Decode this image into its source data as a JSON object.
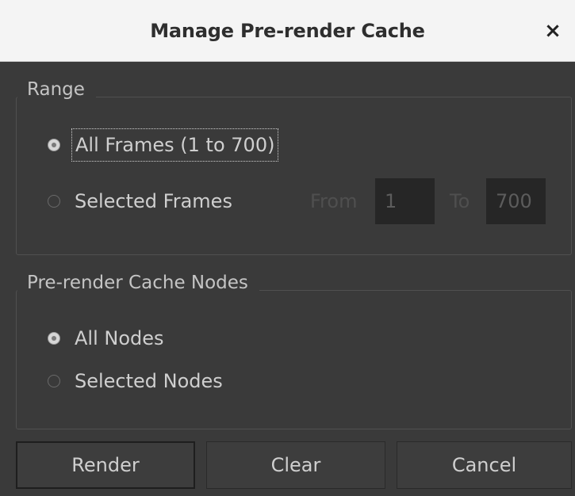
{
  "dialog": {
    "title": "Manage Pre-render Cache",
    "close_glyph": "×"
  },
  "range": {
    "title": "Range",
    "all_frames_label": "All Frames (1 to 700)",
    "selected_frames_label": "Selected Frames",
    "from_label": "From",
    "from_value": "1",
    "to_label": "To",
    "to_value": "700",
    "selected_option": "all_frames"
  },
  "nodes": {
    "title": "Pre-render Cache Nodes",
    "all_nodes_label": "All Nodes",
    "selected_nodes_label": "Selected Nodes",
    "selected_option": "all_nodes"
  },
  "buttons": {
    "render_label": "Render",
    "clear_label": "Clear",
    "cancel_label": "Cancel"
  }
}
